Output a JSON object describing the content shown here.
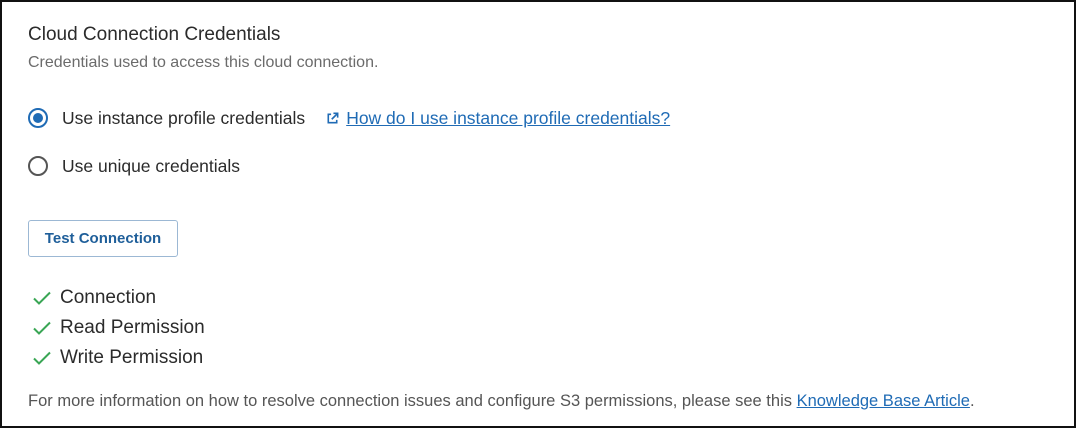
{
  "section": {
    "title": "Cloud Connection Credentials",
    "subtitle": "Credentials used to access this cloud connection."
  },
  "credential_options": [
    {
      "label": "Use instance profile credentials",
      "selected": true
    },
    {
      "label": "Use unique credentials",
      "selected": false
    }
  ],
  "help_link": {
    "text": "How do I use instance profile credentials?",
    "icon": "external-link-icon"
  },
  "test_button": {
    "label": "Test Connection"
  },
  "checks": [
    {
      "label": "Connection",
      "status": "passed",
      "icon": "checkmark-icon"
    },
    {
      "label": "Read Permission",
      "status": "passed",
      "icon": "checkmark-icon"
    },
    {
      "label": "Write Permission",
      "status": "passed",
      "icon": "checkmark-icon"
    }
  ],
  "footer": {
    "prefix": "For more information on how to resolve connection issues and configure S3 permissions, please see this ",
    "link_text": "Knowledge Base Article",
    "suffix": "."
  },
  "colors": {
    "accent": "#1f6bb5",
    "success": "#3aa655",
    "border": "#111111"
  }
}
